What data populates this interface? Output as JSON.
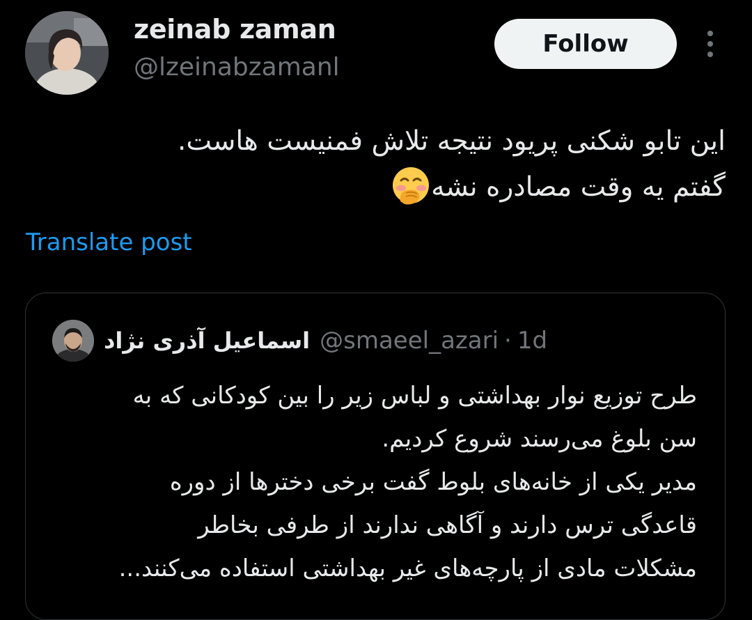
{
  "author": {
    "display_name": "zeinab zaman",
    "handle": "@lzeinabzamanl",
    "avatar_icon": "profile-photo"
  },
  "actions": {
    "follow_label": "Follow",
    "more_icon": "more-vertical-icon"
  },
  "post": {
    "lines": [
      "این تابو شکنی پریود نتیجه تلاش فمنیست هاست.",
      "گفتم یه وقت مصادره نشه"
    ],
    "emoji": "face-with-hand-over-mouth-emoji"
  },
  "translate_label": "Translate post",
  "quoted": {
    "display_name": "اسماعیل آذری نژاد",
    "handle": "@smaeel_azari",
    "separator": "·",
    "time": "1d",
    "lines": [
      "طرح توزیع نوار بهداشتی و لباس زیر را بین کودکانی که به",
      "سن بلوغ می‌رسند شروع کردیم.",
      "مدیر یکی از خانه‌های بلوط گفت برخی دخترها از دوره",
      "قاعدگی ترس دارند و آگاهی ندارند از طرفی بخاطر",
      "مشکلات مادی از پارچه‌های غیر بهداشتی استفاده می‌کنند..."
    ]
  },
  "colors": {
    "background": "#000000",
    "text_primary": "#e7e9ea",
    "text_secondary": "#71767b",
    "link": "#1d9bf0",
    "follow_bg": "#eff3f4",
    "border": "#2f3336"
  }
}
